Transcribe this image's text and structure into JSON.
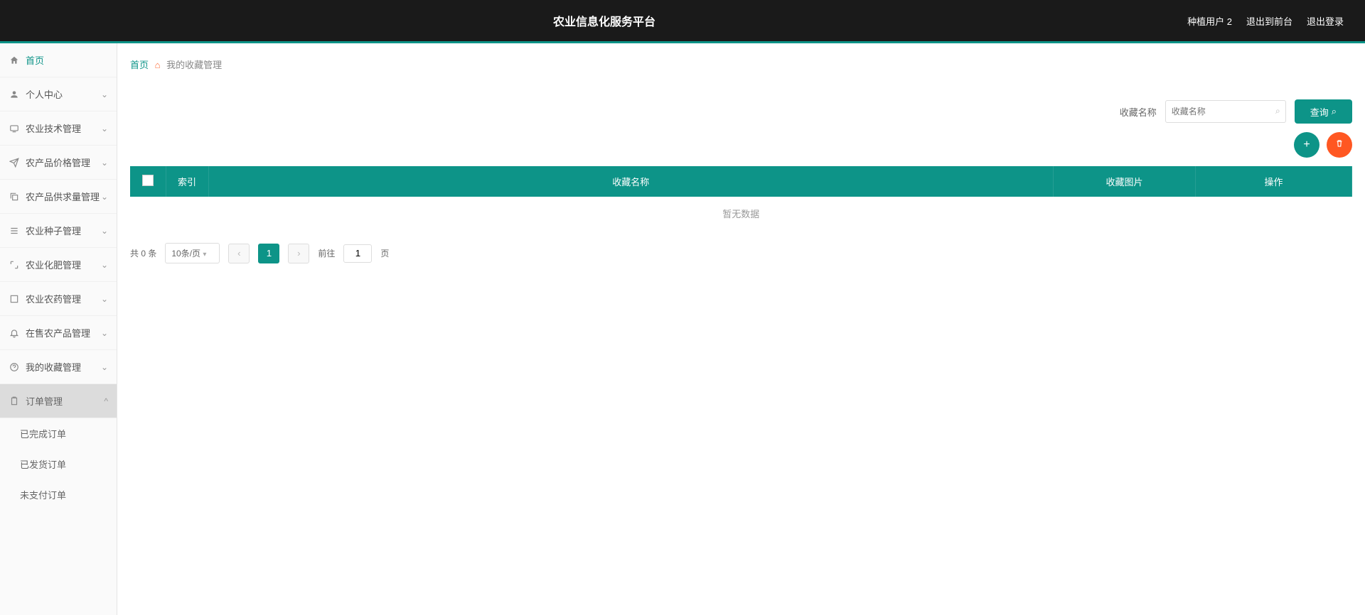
{
  "header": {
    "title": "农业信息化服务平台",
    "user": "种植用户 2",
    "front": "退出到前台",
    "logout": "退出登录"
  },
  "sidebar": {
    "home": "首页",
    "personal": "个人中心",
    "tech": "农业技术管理",
    "price": "农产品价格管理",
    "supply": "农产品供求量管理",
    "seed": "农业种子管理",
    "fert": "农业化肥管理",
    "pesticide": "农业农药管理",
    "sale": "在售农产品管理",
    "fav": "我的收藏管理",
    "order": "订单管理",
    "sub_done": "已完成订单",
    "sub_ship": "已发货订单",
    "sub_unpaid": "未支付订单"
  },
  "breadcrumb": {
    "home": "首页",
    "current": "我的收藏管理"
  },
  "search": {
    "label": "收藏名称",
    "placeholder": "收藏名称",
    "btn": "查询"
  },
  "table": {
    "col_index": "索引",
    "col_name": "收藏名称",
    "col_pic": "收藏图片",
    "col_op": "操作",
    "empty": "暂无数据"
  },
  "pagination": {
    "total": "共 0 条",
    "perpage": "10条/页",
    "goto_pre": "前往",
    "goto_val": "1",
    "goto_suf": "页"
  }
}
